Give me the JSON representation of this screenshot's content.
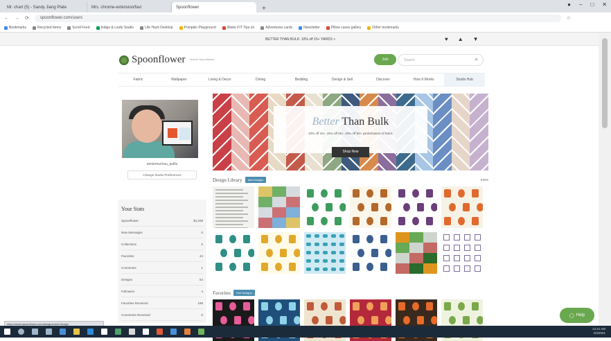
{
  "browser": {
    "tabs": [
      {
        "label": "Mr. chart (5) - Sandy Jiang Plate"
      },
      {
        "label": "Mrs. chrome-extension/favi"
      },
      {
        "label": "Spoonflower"
      }
    ],
    "url": "spoonflower.com/users",
    "bookmarks": [
      {
        "label": "Bookmarks",
        "color": "#4285f4"
      },
      {
        "label": "Recycled Items",
        "color": "#888888"
      },
      {
        "label": "Scroll Feed",
        "color": "#888888"
      },
      {
        "label": "Indigo & Leafy Studio",
        "color": "#0f9d58"
      },
      {
        "label": "Life Hack Desktop",
        "color": "#888888"
      },
      {
        "label": "Pumpkin Playground",
        "color": "#f4b400"
      },
      {
        "label": "Water FIT Tips on",
        "color": "#db4437"
      },
      {
        "label": "Adventures cards",
        "color": "#888888"
      },
      {
        "label": "Newsletter",
        "color": "#4285f4"
      },
      {
        "label": "Pillow cases gallery",
        "color": "#db4437"
      },
      {
        "label": "Other bookmarks",
        "color": "#f4b400"
      }
    ]
  },
  "promo": {
    "text": "BETTER THAN BULK: 10% off 15+ YARDS >",
    "icons": [
      "heart-icon",
      "user-icon",
      "cart-icon"
    ]
  },
  "header": {
    "logo": "Spoonflower",
    "tagline": "search Spoonflower",
    "signin_label": "Join",
    "search_placeholder": "Search"
  },
  "nav": {
    "items": [
      {
        "label": "Fabric",
        "active": false
      },
      {
        "label": "Wallpaper",
        "active": false
      },
      {
        "label": "Living & Decor",
        "active": false
      },
      {
        "label": "Dining",
        "active": false
      },
      {
        "label": "Bedding",
        "active": false
      },
      {
        "label": "Design & Sell",
        "active": false
      },
      {
        "label": "Discover",
        "active": false
      },
      {
        "label": "How It Works",
        "active": false
      },
      {
        "label": "Studio Hub",
        "active": true
      }
    ]
  },
  "profile": {
    "username": "anniemuchau_quilts",
    "change_photo_label": "Change Studio Preferences",
    "stats_title": "Your Stats",
    "stats": [
      {
        "label": "Spoonflower",
        "value": "$1,038"
      },
      {
        "label": "New Messages",
        "value": "0"
      },
      {
        "label": "Collections",
        "value": "0"
      },
      {
        "label": "Favorites",
        "value": "44"
      },
      {
        "label": "Comments",
        "value": "1"
      },
      {
        "label": "Designs",
        "value": "54"
      },
      {
        "label": "Followers",
        "value": "4"
      },
      {
        "label": "Favorites Received",
        "value": "199"
      },
      {
        "label": "Comments Received",
        "value": "0"
      }
    ]
  },
  "banner": {
    "title_italic": "Better",
    "title_rest": " Than Bulk",
    "subtitle": "10% off 15+, 15% off 25+, 20% off 50+ yards/meters of fabric",
    "button_label": "Shop Now",
    "colors": [
      "#c94046",
      "#e8b9b4",
      "#d95c52",
      "#e7d9c4",
      "#c45a4a",
      "#e8e0d0",
      "#8da882",
      "#3f5a7c",
      "#d88a4c",
      "#8b6e9d",
      "#3d6b8d",
      "#a8c6e5",
      "#6b8fc4",
      "#e6d6c9",
      "#c6b2cf"
    ]
  },
  "design_library": {
    "title": "Design Library",
    "badge": "Add Designs",
    "see_more": "more",
    "swatches": [
      {
        "kind": "text",
        "bg": "#f2f2f0",
        "fg": "#b9b9b5"
      },
      {
        "kind": "blocks",
        "bg": "#7fb0d9",
        "fg": "#e8c85a"
      },
      {
        "kind": "motif",
        "bg": "#ffffff",
        "fg": "#3e9c5e"
      },
      {
        "kind": "motif",
        "bg": "#fbf6ea",
        "fg": "#b3692b"
      },
      {
        "kind": "motif",
        "bg": "#ffffff",
        "fg": "#6a3f7a"
      },
      {
        "kind": "motif",
        "bg": "#f7f2e6",
        "fg": "#e06a2e"
      },
      {
        "kind": "motif",
        "bg": "#ffffff",
        "fg": "#2f8f86"
      },
      {
        "kind": "motif",
        "bg": "#fffbe8",
        "fg": "#e2a82a"
      },
      {
        "kind": "dots",
        "bg": "#cfeaf2",
        "fg": "#3aa0b8"
      },
      {
        "kind": "motif",
        "bg": "#ffffff",
        "fg": "#3b5f8f"
      },
      {
        "kind": "blocks",
        "bg": "#2b6b2b",
        "fg": "#f29a1e"
      },
      {
        "kind": "grid",
        "bg": "#ffffff",
        "fg": "#7a6a9a"
      }
    ]
  },
  "favorites": {
    "title": "Favorites",
    "badge": "See Designs",
    "swatches": [
      {
        "bg": "#1a1a1a",
        "fg": "#e85c9a"
      },
      {
        "bg": "#1f4f7a",
        "fg": "#8fd3e8"
      },
      {
        "bg": "#efe4cf",
        "fg": "#c05a3a"
      },
      {
        "bg": "#b3283a",
        "fg": "#f0a05a"
      },
      {
        "bg": "#3a2a1e",
        "fg": "#e86a2a"
      },
      {
        "bg": "#eef3e0",
        "fg": "#7aa84a"
      }
    ]
  },
  "chat": {
    "label": "Help"
  },
  "status_url": "https://www.spoonflower.com/designs/new?design",
  "clock": {
    "time": "12:41 AM",
    "date": "4/3/2021"
  }
}
